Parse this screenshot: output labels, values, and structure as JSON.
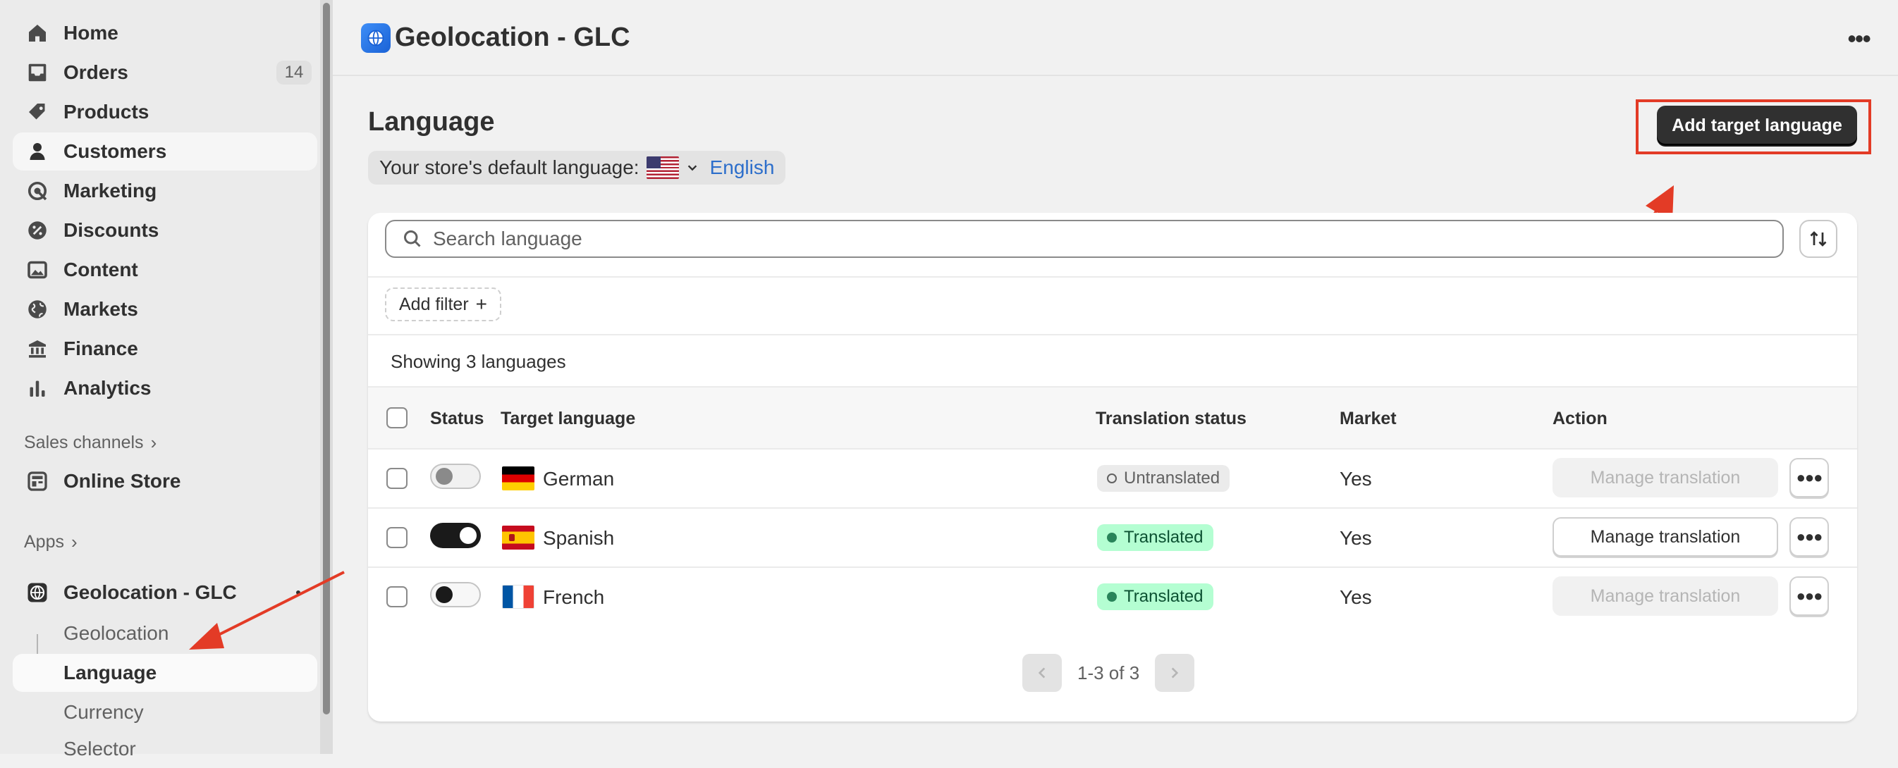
{
  "sidebar": {
    "items": [
      {
        "label": "Home",
        "icon": "home-icon"
      },
      {
        "label": "Orders",
        "icon": "inbox-icon",
        "count": "14"
      },
      {
        "label": "Products",
        "icon": "tag-icon"
      },
      {
        "label": "Customers",
        "icon": "person-icon"
      },
      {
        "label": "Marketing",
        "icon": "target-icon"
      },
      {
        "label": "Discounts",
        "icon": "discount-icon"
      },
      {
        "label": "Content",
        "icon": "image-icon"
      },
      {
        "label": "Markets",
        "icon": "globe-icon"
      },
      {
        "label": "Finance",
        "icon": "bank-icon"
      },
      {
        "label": "Analytics",
        "icon": "bar-chart-icon"
      }
    ],
    "sales_channels_label": "Sales channels",
    "online_store": "Online Store",
    "apps_label": "Apps",
    "app_name": "Geolocation - GLC",
    "app_sub_items": [
      "Geolocation",
      "Language",
      "Currency",
      "Selector"
    ]
  },
  "header": {
    "app_title": "Geolocation - GLC"
  },
  "page": {
    "title": "Language",
    "default_language_label": "Your store's default language:",
    "default_language": "English",
    "add_button": "Add target language"
  },
  "table": {
    "search_placeholder": "Search language",
    "add_filter": "Add filter",
    "showing": "Showing 3 languages",
    "columns": {
      "status": "Status",
      "target_language": "Target language",
      "translation_status": "Translation status",
      "market": "Market",
      "action": "Action"
    },
    "rows": [
      {
        "language": "German",
        "translation_status": "Untranslated",
        "market": "Yes",
        "action": "Manage translation",
        "enabled": false
      },
      {
        "language": "Spanish",
        "translation_status": "Translated",
        "market": "Yes",
        "action": "Manage translation",
        "enabled": true
      },
      {
        "language": "French",
        "translation_status": "Translated",
        "market": "Yes",
        "action": "Manage translation",
        "enabled": false
      }
    ],
    "pagination": "1-3 of 3"
  },
  "colors": {
    "accent_link": "#2c6ecb",
    "primary_button": "#303030",
    "annotation_red": "#e33b26",
    "translated_badge": "#b4fed2"
  }
}
